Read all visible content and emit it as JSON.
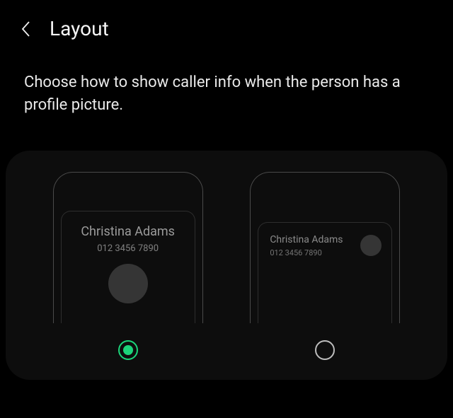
{
  "header": {
    "title": "Layout"
  },
  "description": "Choose how to show caller info when the person has a profile picture.",
  "preview": {
    "caller_name": "Christina Adams",
    "caller_number": "012 3456 7890"
  },
  "options": {
    "selected_index": 0
  },
  "colors": {
    "accent": "#1bd47a"
  }
}
